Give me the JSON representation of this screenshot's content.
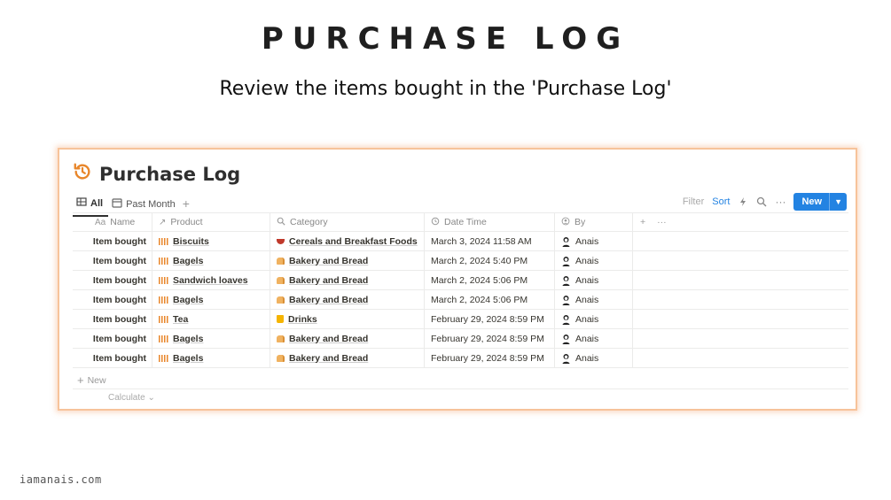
{
  "slide": {
    "title": "PURCHASE LOG",
    "subtitle": "Review the items bought in the 'Purchase Log'",
    "footer": "iamanais.com"
  },
  "database": {
    "title": "Purchase Log",
    "icon": "history-clock-icon",
    "accent_color": "#e8862a",
    "views": [
      {
        "label": "All",
        "icon": "table-icon",
        "active": true
      },
      {
        "label": "Past Month",
        "icon": "calendar-icon",
        "active": false
      }
    ],
    "toolbar": {
      "filter": "Filter",
      "sort": "Sort",
      "new": "New",
      "new_color": "#2383e2"
    },
    "columns": {
      "name": "Name",
      "product": "Product",
      "category": "Category",
      "date": "Date Time",
      "by": "By"
    },
    "rows": [
      {
        "name": "Item bought",
        "product": "Biscuits",
        "category": "Cereals and Breakfast Foods",
        "date": "March 3, 2024 11:58 AM",
        "by": "Anais"
      },
      {
        "name": "Item bought",
        "product": "Bagels",
        "category": "Bakery and Bread",
        "date": "March 2, 2024 5:40 PM",
        "by": "Anais"
      },
      {
        "name": "Item bought",
        "product": "Sandwich loaves",
        "category": "Bakery and Bread",
        "date": "March 2, 2024 5:06 PM",
        "by": "Anais"
      },
      {
        "name": "Item bought",
        "product": "Bagels",
        "category": "Bakery and Bread",
        "date": "March 2, 2024 5:06 PM",
        "by": "Anais"
      },
      {
        "name": "Item bought",
        "product": "Tea",
        "category": "Drinks",
        "date": "February 29, 2024 8:59 PM",
        "by": "Anais"
      },
      {
        "name": "Item bought",
        "product": "Bagels",
        "category": "Bakery and Bread",
        "date": "February 29, 2024 8:59 PM",
        "by": "Anais"
      },
      {
        "name": "Item bought",
        "product": "Bagels",
        "category": "Bakery and Bread",
        "date": "February 29, 2024 8:59 PM",
        "by": "Anais"
      }
    ],
    "new_row_label": "New",
    "calculate_label": "Calculate"
  }
}
